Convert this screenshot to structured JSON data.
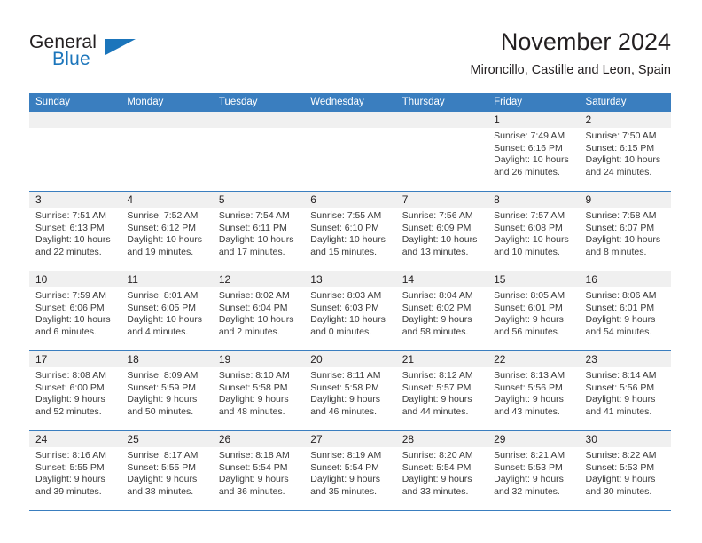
{
  "brand": {
    "name_part1": "General",
    "name_part2": "Blue",
    "triangle_color": "#1b75bb"
  },
  "header": {
    "title": "November 2024",
    "subtitle": "Mironcillo, Castille and Leon, Spain"
  },
  "theme": {
    "header_blue": "#3a7ebf",
    "day_band_grey": "#f0f0f0",
    "text_color": "#231f20",
    "body_text_color": "#3a3a3a"
  },
  "weekdays": [
    "Sunday",
    "Monday",
    "Tuesday",
    "Wednesday",
    "Thursday",
    "Friday",
    "Saturday"
  ],
  "weeks": [
    [
      {
        "day": "",
        "lines": []
      },
      {
        "day": "",
        "lines": []
      },
      {
        "day": "",
        "lines": []
      },
      {
        "day": "",
        "lines": []
      },
      {
        "day": "",
        "lines": []
      },
      {
        "day": "1",
        "lines": [
          "Sunrise: 7:49 AM",
          "Sunset: 6:16 PM",
          "Daylight: 10 hours",
          "and 26 minutes."
        ]
      },
      {
        "day": "2",
        "lines": [
          "Sunrise: 7:50 AM",
          "Sunset: 6:15 PM",
          "Daylight: 10 hours",
          "and 24 minutes."
        ]
      }
    ],
    [
      {
        "day": "3",
        "lines": [
          "Sunrise: 7:51 AM",
          "Sunset: 6:13 PM",
          "Daylight: 10 hours",
          "and 22 minutes."
        ]
      },
      {
        "day": "4",
        "lines": [
          "Sunrise: 7:52 AM",
          "Sunset: 6:12 PM",
          "Daylight: 10 hours",
          "and 19 minutes."
        ]
      },
      {
        "day": "5",
        "lines": [
          "Sunrise: 7:54 AM",
          "Sunset: 6:11 PM",
          "Daylight: 10 hours",
          "and 17 minutes."
        ]
      },
      {
        "day": "6",
        "lines": [
          "Sunrise: 7:55 AM",
          "Sunset: 6:10 PM",
          "Daylight: 10 hours",
          "and 15 minutes."
        ]
      },
      {
        "day": "7",
        "lines": [
          "Sunrise: 7:56 AM",
          "Sunset: 6:09 PM",
          "Daylight: 10 hours",
          "and 13 minutes."
        ]
      },
      {
        "day": "8",
        "lines": [
          "Sunrise: 7:57 AM",
          "Sunset: 6:08 PM",
          "Daylight: 10 hours",
          "and 10 minutes."
        ]
      },
      {
        "day": "9",
        "lines": [
          "Sunrise: 7:58 AM",
          "Sunset: 6:07 PM",
          "Daylight: 10 hours",
          "and 8 minutes."
        ]
      }
    ],
    [
      {
        "day": "10",
        "lines": [
          "Sunrise: 7:59 AM",
          "Sunset: 6:06 PM",
          "Daylight: 10 hours",
          "and 6 minutes."
        ]
      },
      {
        "day": "11",
        "lines": [
          "Sunrise: 8:01 AM",
          "Sunset: 6:05 PM",
          "Daylight: 10 hours",
          "and 4 minutes."
        ]
      },
      {
        "day": "12",
        "lines": [
          "Sunrise: 8:02 AM",
          "Sunset: 6:04 PM",
          "Daylight: 10 hours",
          "and 2 minutes."
        ]
      },
      {
        "day": "13",
        "lines": [
          "Sunrise: 8:03 AM",
          "Sunset: 6:03 PM",
          "Daylight: 10 hours",
          "and 0 minutes."
        ]
      },
      {
        "day": "14",
        "lines": [
          "Sunrise: 8:04 AM",
          "Sunset: 6:02 PM",
          "Daylight: 9 hours",
          "and 58 minutes."
        ]
      },
      {
        "day": "15",
        "lines": [
          "Sunrise: 8:05 AM",
          "Sunset: 6:01 PM",
          "Daylight: 9 hours",
          "and 56 minutes."
        ]
      },
      {
        "day": "16",
        "lines": [
          "Sunrise: 8:06 AM",
          "Sunset: 6:01 PM",
          "Daylight: 9 hours",
          "and 54 minutes."
        ]
      }
    ],
    [
      {
        "day": "17",
        "lines": [
          "Sunrise: 8:08 AM",
          "Sunset: 6:00 PM",
          "Daylight: 9 hours",
          "and 52 minutes."
        ]
      },
      {
        "day": "18",
        "lines": [
          "Sunrise: 8:09 AM",
          "Sunset: 5:59 PM",
          "Daylight: 9 hours",
          "and 50 minutes."
        ]
      },
      {
        "day": "19",
        "lines": [
          "Sunrise: 8:10 AM",
          "Sunset: 5:58 PM",
          "Daylight: 9 hours",
          "and 48 minutes."
        ]
      },
      {
        "day": "20",
        "lines": [
          "Sunrise: 8:11 AM",
          "Sunset: 5:58 PM",
          "Daylight: 9 hours",
          "and 46 minutes."
        ]
      },
      {
        "day": "21",
        "lines": [
          "Sunrise: 8:12 AM",
          "Sunset: 5:57 PM",
          "Daylight: 9 hours",
          "and 44 minutes."
        ]
      },
      {
        "day": "22",
        "lines": [
          "Sunrise: 8:13 AM",
          "Sunset: 5:56 PM",
          "Daylight: 9 hours",
          "and 43 minutes."
        ]
      },
      {
        "day": "23",
        "lines": [
          "Sunrise: 8:14 AM",
          "Sunset: 5:56 PM",
          "Daylight: 9 hours",
          "and 41 minutes."
        ]
      }
    ],
    [
      {
        "day": "24",
        "lines": [
          "Sunrise: 8:16 AM",
          "Sunset: 5:55 PM",
          "Daylight: 9 hours",
          "and 39 minutes."
        ]
      },
      {
        "day": "25",
        "lines": [
          "Sunrise: 8:17 AM",
          "Sunset: 5:55 PM",
          "Daylight: 9 hours",
          "and 38 minutes."
        ]
      },
      {
        "day": "26",
        "lines": [
          "Sunrise: 8:18 AM",
          "Sunset: 5:54 PM",
          "Daylight: 9 hours",
          "and 36 minutes."
        ]
      },
      {
        "day": "27",
        "lines": [
          "Sunrise: 8:19 AM",
          "Sunset: 5:54 PM",
          "Daylight: 9 hours",
          "and 35 minutes."
        ]
      },
      {
        "day": "28",
        "lines": [
          "Sunrise: 8:20 AM",
          "Sunset: 5:54 PM",
          "Daylight: 9 hours",
          "and 33 minutes."
        ]
      },
      {
        "day": "29",
        "lines": [
          "Sunrise: 8:21 AM",
          "Sunset: 5:53 PM",
          "Daylight: 9 hours",
          "and 32 minutes."
        ]
      },
      {
        "day": "30",
        "lines": [
          "Sunrise: 8:22 AM",
          "Sunset: 5:53 PM",
          "Daylight: 9 hours",
          "and 30 minutes."
        ]
      }
    ]
  ]
}
